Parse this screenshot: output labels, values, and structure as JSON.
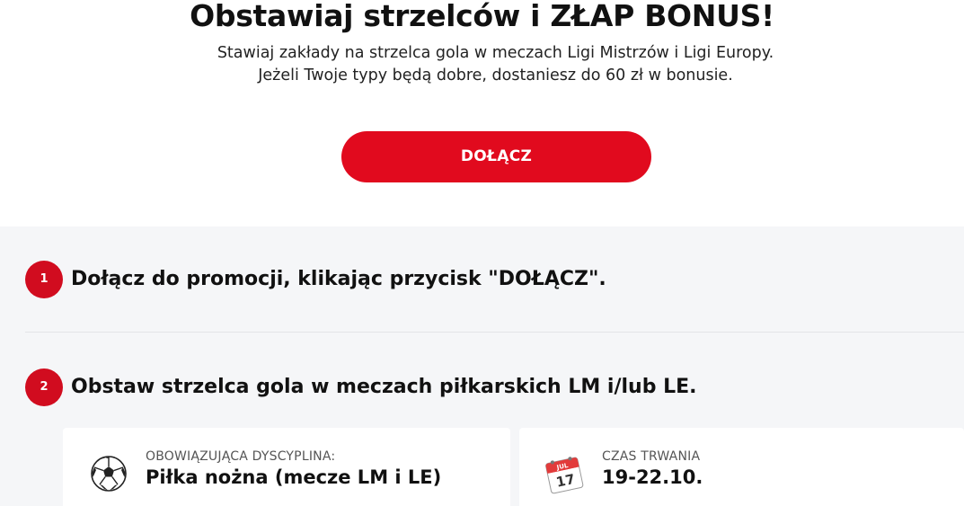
{
  "hero": {
    "title": "Obstawiaj strzelców i ZŁAP BONUS!",
    "subtitle_line1": "Stawiaj zakłady na strzelca gola w meczach Ligi Mistrzów i Ligi Europy.",
    "subtitle_line2": "Jeżeli Twoje typy będą dobre, dostaniesz do 60 zł w bonusie.",
    "join_button": "DOŁĄCZ"
  },
  "steps": [
    {
      "number": "1",
      "text": "Dołącz do promocji, klikając przycisk \"DOŁĄCZ\"."
    },
    {
      "number": "2",
      "text": "Obstaw strzelca gola w meczach piłkarskich LM i/lub LE."
    }
  ],
  "cards": [
    {
      "icon": "soccer-ball-icon",
      "label": "OBOWIĄZUJĄCA DYSCYPLINA:",
      "value": "Piłka nożna (mecze LM i LE)"
    },
    {
      "icon": "calendar-icon",
      "label": "CZAS TRWANIA",
      "value": "19-22.10.",
      "calendar_month": "JUL",
      "calendar_day": "17"
    }
  ],
  "colors": {
    "accent": "#e10a1e",
    "badge": "#d10c1f",
    "section_bg": "#f5f6f8"
  }
}
